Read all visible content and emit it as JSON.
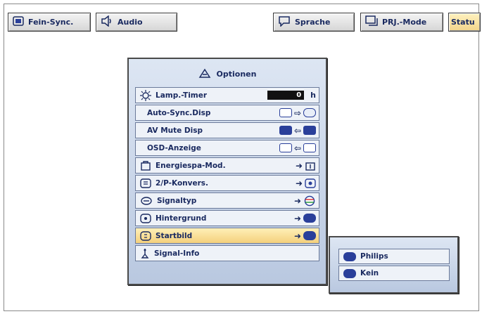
{
  "tabs": [
    {
      "label": "Fein-Sync.",
      "icon": "fine-sync-icon"
    },
    {
      "label": "Audio",
      "icon": "speaker-icon"
    },
    {
      "label": "Sprache",
      "icon": "speech-bubble-icon"
    },
    {
      "label": "PRJ.-Mode",
      "icon": "projector-mode-icon"
    },
    {
      "label": "Statu",
      "icon": "",
      "active": true
    }
  ],
  "menu": {
    "title": "Optionen",
    "items": [
      {
        "label": "Lamp.-Timer",
        "icon": "lamp-icon",
        "value": "0",
        "unit": "h"
      },
      {
        "label": "Auto-Sync.Disp"
      },
      {
        "label": "AV Mute Disp"
      },
      {
        "label": "OSD-Anzeige"
      },
      {
        "label": "Energiespa-Mod.",
        "icon": "energy-save-icon"
      },
      {
        "label": "2/P-Konvers.",
        "icon": "progressive-icon"
      },
      {
        "label": "Signaltyp",
        "icon": "signal-type-icon"
      },
      {
        "label": "Hintergrund",
        "icon": "background-icon"
      },
      {
        "label": "Startbild",
        "icon": "startup-image-icon",
        "selected": true
      },
      {
        "label": "Signal-Info",
        "icon": "signal-info-icon"
      }
    ]
  },
  "submenu": {
    "options": [
      {
        "label": "Philips",
        "icon": "philips-logo-icon"
      },
      {
        "label": "Kein",
        "icon": "blank-screen-icon"
      }
    ]
  },
  "colors": {
    "accent_blue": "#2a3f9a",
    "highlight": "#f4d07c",
    "text": "#1a2a60"
  }
}
